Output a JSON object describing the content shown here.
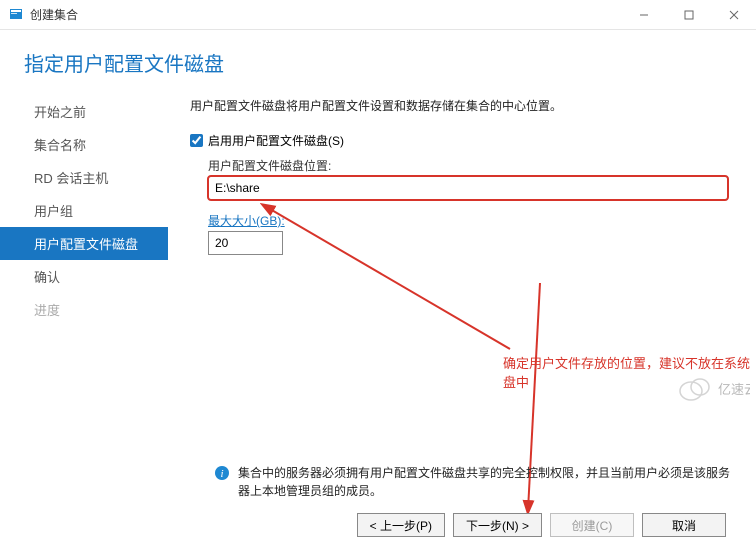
{
  "window": {
    "title": "创建集合"
  },
  "page": {
    "heading": "指定用户配置文件磁盘"
  },
  "sidebar": {
    "items": [
      {
        "label": "开始之前"
      },
      {
        "label": "集合名称"
      },
      {
        "label": "RD 会话主机"
      },
      {
        "label": "用户组"
      },
      {
        "label": "用户配置文件磁盘"
      },
      {
        "label": "确认"
      },
      {
        "label": "进度"
      }
    ]
  },
  "main": {
    "description": "用户配置文件磁盘将用户配置文件设置和数据存储在集合的中心位置。",
    "enable_checkbox_label": "启用用户配置文件磁盘(S)",
    "location_label": "用户配置文件磁盘位置:",
    "location_value": "E:\\share",
    "maxsize_label": "最大大小(GB):",
    "maxsize_value": "20",
    "info_text": "集合中的服务器必须拥有用户配置文件磁盘共享的完全控制权限，并且当前用户必须是该服务器上本地管理员组的成员。"
  },
  "annotation": {
    "text": "确定用户文件存放的位置，建议不放在系统盘中"
  },
  "buttons": {
    "prev": "< 上一步(P)",
    "next": "下一步(N) >",
    "create": "创建(C)",
    "cancel": "取消"
  },
  "watermark": {
    "text": "亿速云"
  }
}
